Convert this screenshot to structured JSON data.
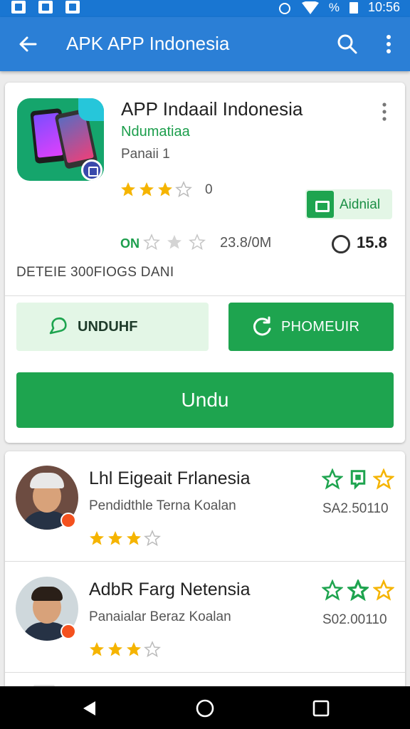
{
  "status_bar": {
    "time": "10:56",
    "battery_text": "%"
  },
  "app_bar": {
    "title": "APK APP Indonesia"
  },
  "app": {
    "title": "APP Indaail Indonesia",
    "developer": "Ndumatiaa",
    "subtitle": "Panaii 1",
    "rating_count": "0",
    "rating_stars": 3,
    "platform_badge": "Aidnial",
    "on_label": "ON",
    "size": "23.8/0M",
    "version": "15.8",
    "section_label": "DETEIE 300FIOGS DANI"
  },
  "buttons": {
    "secondary": "UNDUHF",
    "primary_alt": "PHOMEUIR",
    "install": "Undu"
  },
  "reviews": [
    {
      "name": "Lhl Eigeait Frlanesia",
      "desc": "Pendidthle Terna Koalan",
      "code": "SA2.50110",
      "stars": 3
    },
    {
      "name": "AdbR Farg Netensia",
      "desc": "Panaialar Beraz Koalan",
      "code": "S02.00110",
      "stars": 3
    }
  ],
  "colors": {
    "primary": "#2b7fd6",
    "accent_green": "#1ea44f",
    "star": "#f5b400"
  },
  "icons": [
    "back-arrow-icon",
    "search-icon",
    "more-vert-icon",
    "chat-bubble-icon",
    "refresh-icon",
    "star-icon",
    "nav-back-icon",
    "nav-home-icon",
    "nav-recents-icon"
  ]
}
